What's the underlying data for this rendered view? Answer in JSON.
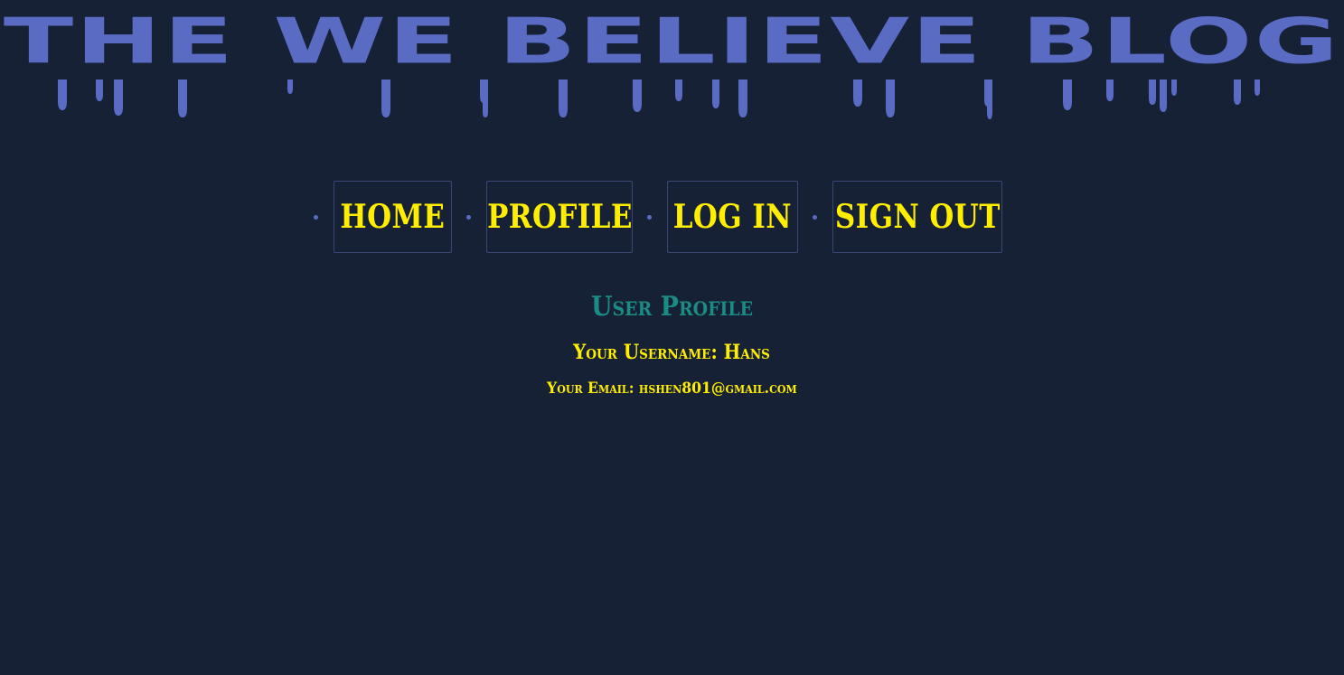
{
  "site": {
    "title": "THE WE BELIEVE BLOG"
  },
  "nav": {
    "items": [
      {
        "label": "HOME"
      },
      {
        "label": "PROFILE"
      },
      {
        "label": "LOG IN"
      },
      {
        "label": "SIGN OUT"
      }
    ]
  },
  "profile": {
    "heading": "User Profile",
    "username_line": "Your Username: Hans",
    "email_line": "Your Email: hshen801@gmail.com"
  },
  "colors": {
    "background": "#172135",
    "title": "#5a6bc4",
    "nav_text": "#ffee00",
    "nav_border": "#3a4774",
    "heading": "#1a8c84",
    "body_text": "#ffee00"
  }
}
